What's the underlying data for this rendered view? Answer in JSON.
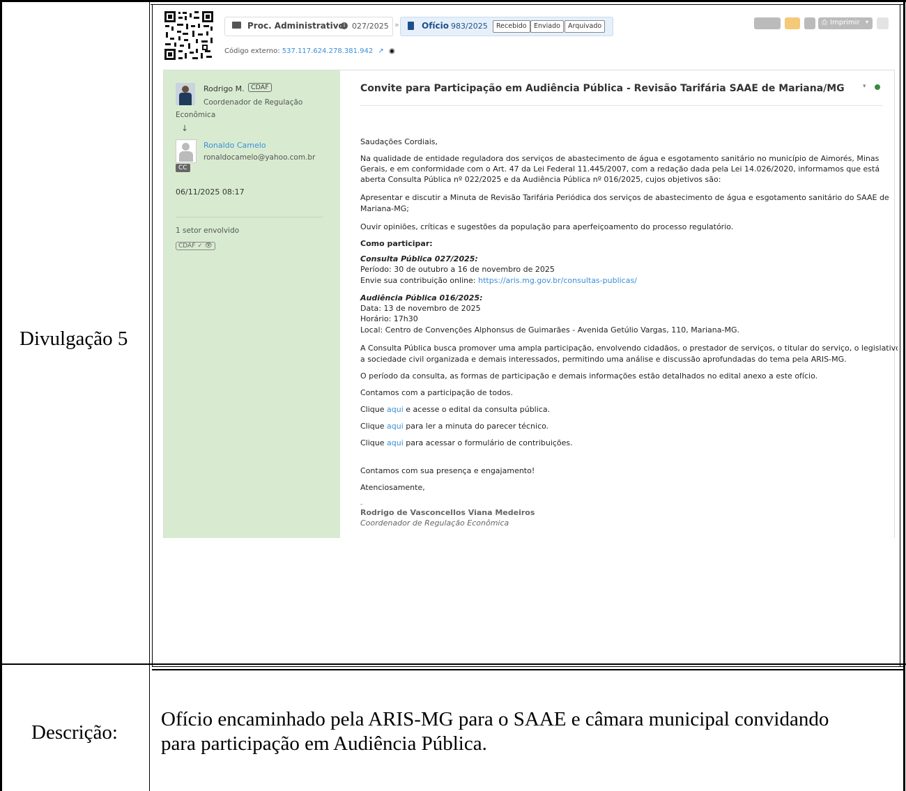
{
  "document": {
    "row1_label": "Divulgação 5",
    "row2_label": "Descrição:",
    "description_line1": "Ofício encaminhado pela ARIS-MG para o SAAE e câmara municipal convidando",
    "description_line2": "para participação em Audiência Pública."
  },
  "screenshot": {
    "breadcrumb": {
      "proc_label": "Proc. Administrativo",
      "proc_number": "027/2025",
      "separator": "»",
      "oficio_label": "Ofício",
      "oficio_number": "983/2025",
      "tags": [
        "Recebido",
        "Enviado",
        "Arquivado"
      ]
    },
    "external_code_label": "Código externo:",
    "external_code": "537.117.624.278.381.942",
    "toolbar": {
      "print_label": "Imprimir"
    },
    "sender": {
      "name": "Rodrigo M.",
      "badge": "CDAF",
      "role_line1": "Coordenador de Regulação",
      "role_line2": "Econômica"
    },
    "recipient": {
      "name": "Ronaldo Camelo",
      "email": "ronaldocamelo@yahoo.com.br",
      "badge": "CC"
    },
    "datetime": "06/11/2025 08:17",
    "sectors_label": "1 setor envolvido",
    "sector_badge": "CDAF ✓ 👁",
    "subject": "Convite para Participação em Audiência Pública - Revisão Tarifária SAAE de Mariana/MG",
    "body": {
      "greeting": "Saudações Cordiais,",
      "p1_line1": "Na qualidade de entidade reguladora dos serviços de abastecimento de água e esgotamento sanitário no município de Aimorés, Minas",
      "p1_line2": "Gerais, e em conformidade com o Art. 47 da Lei Federal 11.445/2007, com a redação dada pela Lei 14.026/2020, informamos que está",
      "p1_line3": "aberta Consulta Pública nº 022/2025 e da Audiência Pública nº 016/2025, cujos objetivos são:",
      "p2_line1": "Apresentar e discutir a Minuta de Revisão Tarifária Periódica dos serviços de abastecimento de água e esgotamento sanitário do SAAE de",
      "p2_line2": "Mariana-MG;",
      "p3": "Ouvir opiniões, críticas e sugestões da população para aperfeiçoamento do processo regulatório.",
      "how_title": "Como participar:",
      "cp_title": "Consulta Pública 027/2025:",
      "cp_period": "Período: 30 de outubro a 16 de novembro de 2025",
      "cp_send": "Envie sua contribuição online:",
      "cp_link": "https://aris.mg.gov.br/consultas-publicas/",
      "ap_title": "Audiência Pública 016/2025:",
      "ap_date": "Data: 13 de novembro de 2025",
      "ap_time": "Horário: 17h30",
      "ap_place": "Local: Centro de Convenções Alphonsus de Guimarães - Avenida Getúlio Vargas, 110, Mariana-MG.",
      "p4_line1": "A Consulta Pública busca promover uma ampla participação, envolvendo cidadãos, o prestador de serviços, o titular do serviço, o legislativo,",
      "p4_line2": "a sociedade civil organizada e demais interessados, permitindo uma análise e discussão aprofundadas do tema pela ARIS-MG.",
      "p5": "O período da consulta, as formas de participação e demais informações estão detalhados no edital anexo a este ofício.",
      "p6": "Contamos com a participação de todos.",
      "click_prefix": "Clique",
      "click_link": "aqui",
      "click1_suffix": "e acesse o edital da consulta pública.",
      "click2_suffix": "para ler a minuta do parecer técnico.",
      "click3_suffix": "para acessar o formulário de contribuições.",
      "closing1": "Contamos com sua presença e engajamento!",
      "closing2": "Atenciosamente,",
      "sig_dash": "-",
      "sig_name": "Rodrigo de Vasconcellos Viana Medeiros",
      "sig_role": "Coordenador de Regulação Econômica"
    }
  }
}
